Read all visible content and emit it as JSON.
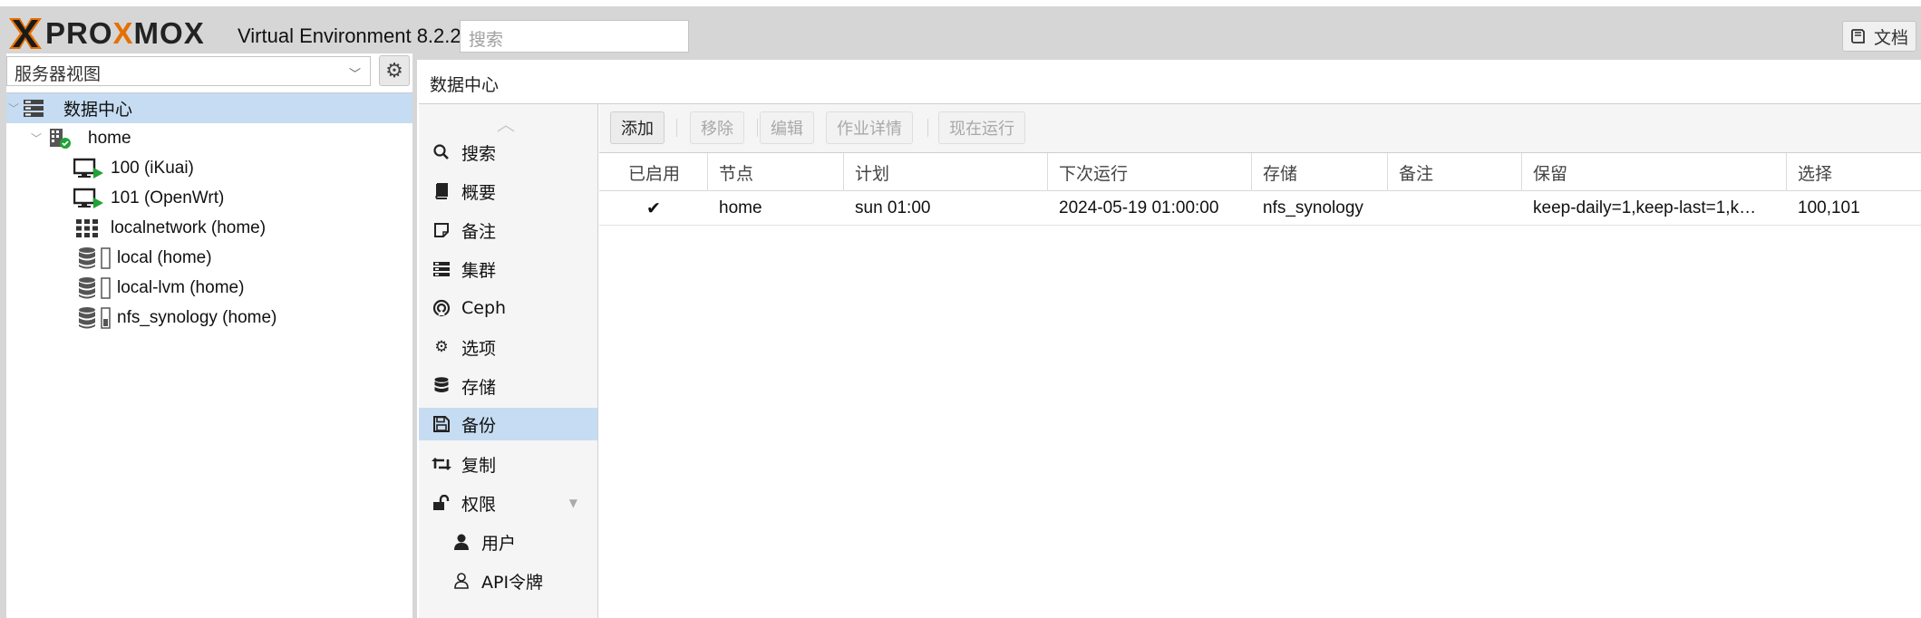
{
  "header": {
    "logo_text_prefix": "PRO",
    "logo_text_mid": "X",
    "logo_text_suffix": "MOX",
    "version": "Virtual Environment 8.2.2",
    "search_placeholder": "搜索",
    "docs_label": "文档"
  },
  "sidebar": {
    "view_select": "服务器视图",
    "tree": [
      {
        "label": "数据中心",
        "icon": "datacenter-icon",
        "selected": true
      },
      {
        "label": "home",
        "icon": "node-online-icon"
      },
      {
        "label": "100 (iKuai)",
        "icon": "vm-running-icon"
      },
      {
        "label": "101 (OpenWrt)",
        "icon": "vm-running-icon"
      },
      {
        "label": "localnetwork (home)",
        "icon": "sdn-grid-icon"
      },
      {
        "label": "local (home)",
        "icon": "storage-icon"
      },
      {
        "label": "local-lvm (home)",
        "icon": "storage-icon"
      },
      {
        "label": "nfs_synology (home)",
        "icon": "storage-icon"
      }
    ]
  },
  "content": {
    "title": "数据中心"
  },
  "nav": {
    "items": [
      {
        "label": "搜索",
        "icon": "search-icon"
      },
      {
        "label": "概要",
        "icon": "book-icon"
      },
      {
        "label": "备注",
        "icon": "note-icon"
      },
      {
        "label": "集群",
        "icon": "server-icon"
      },
      {
        "label": "Ceph",
        "icon": "ceph-icon"
      },
      {
        "label": "选项",
        "icon": "gear-icon"
      },
      {
        "label": "存储",
        "icon": "database-icon"
      },
      {
        "label": "备份",
        "icon": "floppy-icon",
        "selected": true
      },
      {
        "label": "复制",
        "icon": "retweet-icon"
      },
      {
        "label": "权限",
        "icon": "unlock-icon"
      },
      {
        "label": "用户",
        "icon": "user-icon"
      },
      {
        "label": "API令牌",
        "icon": "user-outline-icon"
      }
    ]
  },
  "toolbar": {
    "add": "添加",
    "remove": "移除",
    "edit": "编辑",
    "job_detail": "作业详情",
    "run_now": "现在运行"
  },
  "grid": {
    "columns": [
      "已启用",
      "节点",
      "计划",
      "下次运行",
      "存储",
      "备注",
      "保留",
      "选择"
    ],
    "rows": [
      {
        "enabled": "✔",
        "node": "home",
        "schedule": "sun 01:00",
        "next_run": "2024-05-19 01:00:00",
        "storage": "nfs_synology",
        "comment": "",
        "retention": "keep-daily=1,keep-last=1,k…",
        "selection": "100,101"
      }
    ]
  }
}
